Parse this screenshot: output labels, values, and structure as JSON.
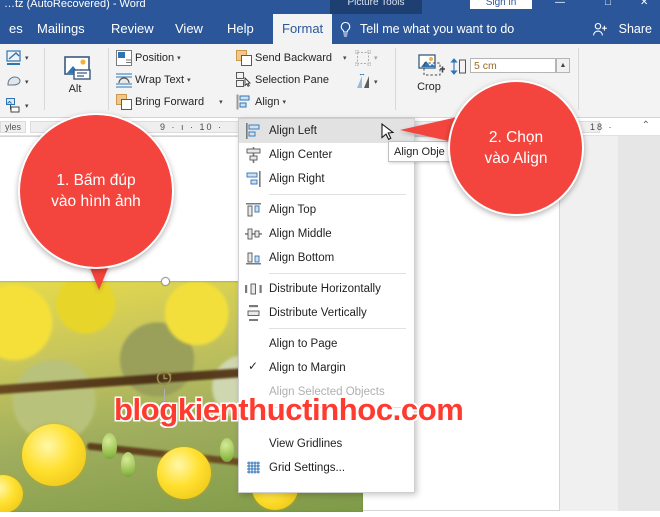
{
  "titlebar": {
    "document_title": "…tz (AutoRecovered)  -  Word",
    "contextual_tools": "Picture Tools",
    "sign_in": "Sign in",
    "minimize": "—",
    "restore": "□",
    "close": "✕"
  },
  "tabs": [
    {
      "label": "es",
      "active": false
    },
    {
      "label": "Mailings",
      "active": false
    },
    {
      "label": "Review",
      "active": false
    },
    {
      "label": "View",
      "active": false
    },
    {
      "label": "Help",
      "active": false
    },
    {
      "label": "Format",
      "active": true
    }
  ],
  "tellme": {
    "label": "Tell me what you want to do",
    "icon": "lightbulb-icon"
  },
  "share": {
    "label": "Share",
    "icon": "share-person-icon"
  },
  "ribbon": {
    "left_icons": [
      {
        "name": "picture-border-icon"
      },
      {
        "name": "picture-effects-icon"
      },
      {
        "name": "picture-layout-icon"
      }
    ],
    "alt_text": {
      "label": "Alt",
      "icon": "alt-text-icon"
    },
    "arrange": [
      {
        "label": "Position",
        "icon": "position-icon",
        "caret": "▾"
      },
      {
        "label": "Wrap Text",
        "icon": "wrap-text-icon",
        "caret": "▾"
      },
      {
        "label": "Bring Forward",
        "icon": "bring-forward-icon",
        "caret": "▾"
      },
      {
        "label": "Send Backward",
        "icon": "send-backward-icon",
        "caret": "▾"
      },
      {
        "label": "Selection Pane",
        "icon": "selection-pane-icon",
        "caret": ""
      },
      {
        "label": "Align",
        "icon": "align-icon",
        "caret": "▾"
      }
    ],
    "group_icons": [
      {
        "name": "group-objects-icon",
        "caret": "▾"
      },
      {
        "name": "rotate-objects-icon",
        "caret": "▾"
      }
    ],
    "crop": {
      "label": "Crop",
      "icon": "crop-icon"
    },
    "size": {
      "height_icon": "shape-height-icon",
      "height_value": "5 cm",
      "spin_up": "▲"
    }
  },
  "ruler": {
    "left_label": "yles",
    "ticks_left": "9  ·  ı  ·  10  ·",
    "ticks_right": "18  ·",
    "collapse_caret": "⌃"
  },
  "align_menu": {
    "items": [
      {
        "label": "Align Left",
        "accel": "L",
        "icon": "align-left-icon",
        "selected": true,
        "checked": false,
        "disabled": false,
        "sep_after": false
      },
      {
        "label": "Align Center",
        "accel": "C",
        "icon": "align-center-icon",
        "selected": false,
        "checked": false,
        "disabled": false,
        "sep_after": false
      },
      {
        "label": "Align Right",
        "accel": "R",
        "icon": "align-right-icon",
        "selected": false,
        "checked": false,
        "disabled": false,
        "sep_after": true
      },
      {
        "label": "Align Top",
        "accel": "T",
        "icon": "align-top-icon",
        "selected": false,
        "checked": false,
        "disabled": false,
        "sep_after": false
      },
      {
        "label": "Align Middle",
        "accel": "M",
        "icon": "align-middle-icon",
        "selected": false,
        "checked": false,
        "disabled": false,
        "sep_after": false
      },
      {
        "label": "Align Bottom",
        "accel": "B",
        "icon": "align-bottom-icon",
        "selected": false,
        "checked": false,
        "disabled": false,
        "sep_after": true
      },
      {
        "label": "Distribute Horizontally",
        "accel": "H",
        "icon": "distribute-h-icon",
        "selected": false,
        "checked": false,
        "disabled": false,
        "sep_after": false
      },
      {
        "label": "Distribute Vertically",
        "accel": "V",
        "icon": "distribute-v-icon",
        "selected": false,
        "checked": false,
        "disabled": false,
        "sep_after": true
      },
      {
        "label": "Align to Page",
        "accel": "P",
        "icon": "",
        "selected": false,
        "checked": false,
        "disabled": false,
        "sep_after": false
      },
      {
        "label": "Align to Margin",
        "accel": "A",
        "icon": "check-icon",
        "selected": false,
        "checked": true,
        "disabled": false,
        "sep_after": false
      },
      {
        "label": "Align Selected Objects",
        "accel": "O",
        "icon": "",
        "selected": false,
        "checked": false,
        "disabled": true,
        "sep_after": true
      },
      {
        "label": "View Gridlines",
        "accel": "s",
        "icon": "",
        "selected": false,
        "checked": false,
        "disabled": false,
        "sep_after": false
      },
      {
        "label": "Grid Settings...",
        "accel": "G",
        "icon": "grid-settings-icon",
        "selected": false,
        "checked": false,
        "disabled": false,
        "sep_after": false
      }
    ]
  },
  "tooltip": {
    "text": "Align Obje"
  },
  "callouts": [
    {
      "line1": "1. Bấm đúp",
      "line2": "vào hình ảnh",
      "color": "#f4443e"
    },
    {
      "line1": "2. Chọn",
      "line2": "vào Align",
      "color": "#f4443e"
    }
  ],
  "watermark": {
    "text": "blogkienthuctinhoc.com",
    "color": "#ff3b30"
  },
  "picture": {
    "alt": "yellow apricot blossoms on branches"
  }
}
